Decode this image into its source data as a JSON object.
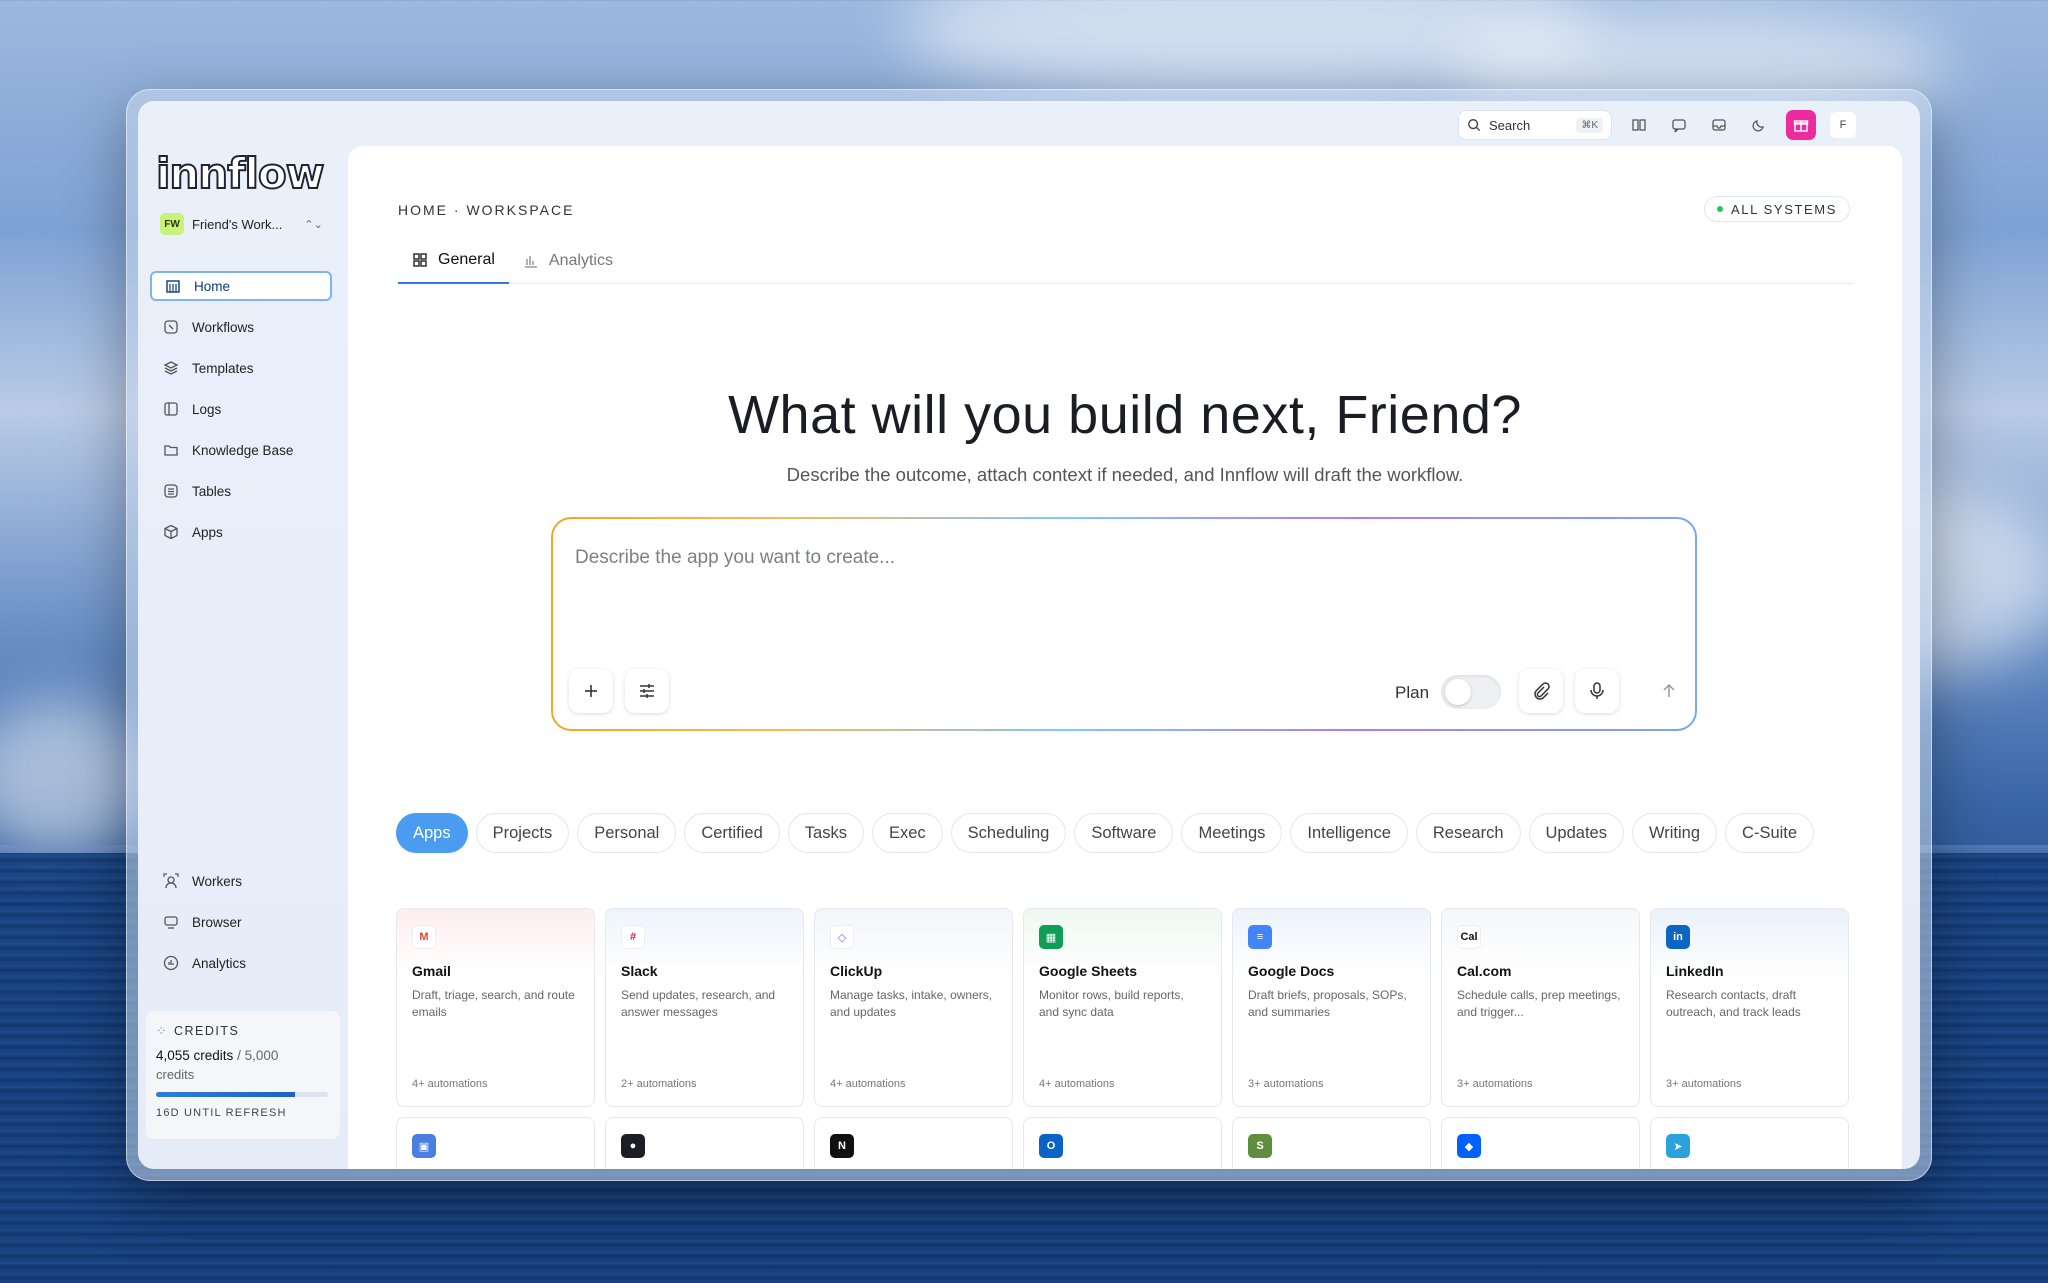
{
  "topbar": {
    "search_label": "Search",
    "search_shortcut": "⌘K",
    "avatar_initial": "F"
  },
  "sidebar": {
    "logo": "innflow",
    "workspace": {
      "badge": "FW",
      "name": "Friend's Work..."
    },
    "nav": [
      {
        "label": "Home",
        "icon": "home-icon"
      },
      {
        "label": "Workflows",
        "icon": "workflow-icon"
      },
      {
        "label": "Templates",
        "icon": "layers-icon"
      },
      {
        "label": "Logs",
        "icon": "book-icon"
      },
      {
        "label": "Knowledge Base",
        "icon": "folder-icon"
      },
      {
        "label": "Tables",
        "icon": "table-icon"
      },
      {
        "label": "Apps",
        "icon": "cube-icon"
      }
    ],
    "nav_bottom": [
      {
        "label": "Workers",
        "icon": "worker-icon"
      },
      {
        "label": "Browser",
        "icon": "monitor-icon"
      },
      {
        "label": "Analytics",
        "icon": "chart-icon"
      }
    ],
    "credits": {
      "heading": "CREDITS",
      "used": "4,055 credits",
      "total": "/ 5,000",
      "unit": "credits",
      "fraction": 0.811,
      "refresh": "16D UNTIL REFRESH"
    }
  },
  "main": {
    "breadcrumb": "HOME · WORKSPACE",
    "status": "ALL SYSTEMS",
    "tabs": [
      {
        "label": "General"
      },
      {
        "label": "Analytics"
      }
    ],
    "hero_title": "What will you build next, Friend?",
    "hero_subtitle": "Describe the outcome, attach context if needed, and Innflow will draft the workflow.",
    "prompt_placeholder": "Describe the app you want to create...",
    "plan_label": "Plan",
    "chips": [
      "Apps",
      "Projects",
      "Personal",
      "Certified",
      "Tasks",
      "Exec",
      "Scheduling",
      "Software",
      "Meetings",
      "Intelligence",
      "Research",
      "Updates",
      "Writing",
      "C-Suite"
    ],
    "cards": [
      {
        "title": "Gmail",
        "desc": "Draft, triage, search, and route emails",
        "count": "4+ automations",
        "color": "#ffffff",
        "glyph": "M",
        "glyph_color": "#ea4335",
        "tint": "#fdeef0"
      },
      {
        "title": "Slack",
        "desc": "Send updates, research, and answer messages",
        "count": "2+ automations",
        "color": "#ffffff",
        "glyph": "#",
        "glyph_color": "#e01e5a",
        "tint": "#eef4fc"
      },
      {
        "title": "ClickUp",
        "desc": "Manage tasks, intake, owners, and updates",
        "count": "4+ automations",
        "color": "#ffffff",
        "glyph": "◇",
        "glyph_color": "#7b68ee",
        "tint": "#f3f5fa"
      },
      {
        "title": "Google Sheets",
        "desc": "Monitor rows, build reports, and sync data",
        "count": "4+ automations",
        "color": "#0f9d58",
        "glyph": "▦",
        "glyph_color": "#ffffff",
        "tint": "#eef8f1"
      },
      {
        "title": "Google Docs",
        "desc": "Draft briefs, proposals, SOPs, and summaries",
        "count": "3+ automations",
        "color": "#4285f4",
        "glyph": "≡",
        "glyph_color": "#ffffff",
        "tint": "#eef3fc"
      },
      {
        "title": "Cal.com",
        "desc": "Schedule calls, prep meetings, and trigger...",
        "count": "3+ automations",
        "color": "#ffffff",
        "glyph": "Cal",
        "glyph_color": "#111111",
        "tint": "#f6f7f9"
      },
      {
        "title": "LinkedIn",
        "desc": "Research contacts, draft outreach, and track leads",
        "count": "3+ automations",
        "color": "#0a66c2",
        "glyph": "in",
        "glyph_color": "#ffffff",
        "tint": "#eaf1fa"
      }
    ],
    "cards_row2_icons": [
      {
        "name": "outlook-calendar-icon",
        "color": "#4a7ee0",
        "glyph": "▣"
      },
      {
        "name": "github-icon",
        "color": "#1b1f23",
        "glyph": "●"
      },
      {
        "name": "notion-icon",
        "color": "#111111",
        "glyph": "N"
      },
      {
        "name": "outlook-icon",
        "color": "#0a64c8",
        "glyph": "O"
      },
      {
        "name": "shopify-icon",
        "color": "#5e8e3e",
        "glyph": "S"
      },
      {
        "name": "dropbox-icon",
        "color": "#0061ff",
        "glyph": "◆"
      },
      {
        "name": "telegram-icon",
        "color": "#2aa3dd",
        "glyph": "➤"
      }
    ]
  }
}
